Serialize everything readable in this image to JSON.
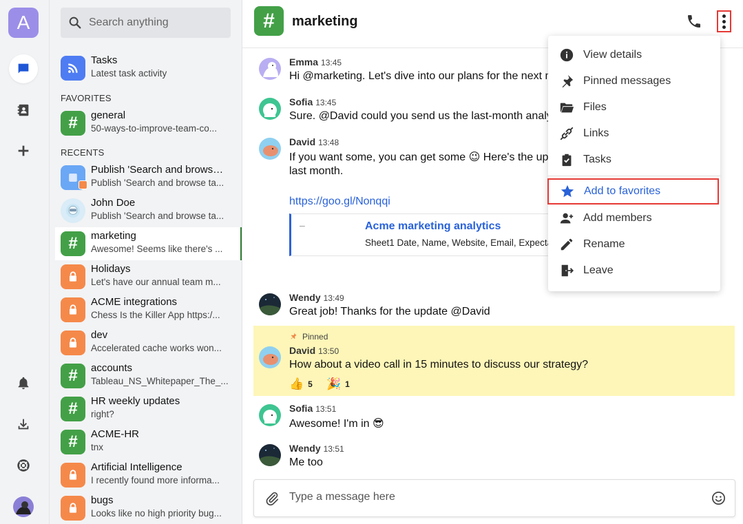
{
  "rail": {
    "avatar_letter": "A"
  },
  "search": {
    "placeholder": "Search anything"
  },
  "sidebar": {
    "tasks": {
      "title": "Tasks",
      "subtitle": "Latest task activity"
    },
    "favorites_label": "FAVORITES",
    "favorites": [
      {
        "title": "general",
        "subtitle": "50-ways-to-improve-team-co..."
      }
    ],
    "recents_label": "RECENTS",
    "recents": [
      {
        "title": "Publish 'Search and browse ...",
        "subtitle": "Publish 'Search and browse ta...",
        "icon": "task-icon"
      },
      {
        "title": "John Doe",
        "subtitle": "Publish 'Search and browse ta...",
        "icon": "avatar"
      },
      {
        "title": "marketing",
        "subtitle": "Awesome! Seems like there's ...",
        "icon": "hash-icon"
      },
      {
        "title": "Holidays",
        "subtitle": "Let's have our annual team m...",
        "icon": "lock-icon"
      },
      {
        "title": "ACME integrations",
        "subtitle": "Chess Is the Killer App https:/...",
        "icon": "lock-icon"
      },
      {
        "title": "dev",
        "subtitle": "Accelerated cache works won...",
        "icon": "lock-icon"
      },
      {
        "title": "accounts",
        "subtitle": "Tableau_NS_Whitepaper_The_...",
        "icon": "hash-icon"
      },
      {
        "title": "HR weekly updates",
        "subtitle": "right?",
        "icon": "hash-icon"
      },
      {
        "title": "ACME-HR",
        "subtitle": "tnx",
        "icon": "hash-icon"
      },
      {
        "title": "Artificial Intelligence",
        "subtitle": "I recently found more informa...",
        "icon": "lock-icon"
      },
      {
        "title": "bugs",
        "subtitle": "Looks like no high priority bug...",
        "icon": "lock-icon"
      }
    ]
  },
  "header": {
    "channel_icon": "#",
    "title": "marketing"
  },
  "messages": [
    {
      "name": "Emma",
      "time": "13:45",
      "text": "Hi @marketing. Let's dive into our plans for the next m"
    },
    {
      "name": "Sofia",
      "time": "13:45",
      "text": "Sure. @David could you send us the last-month analyt"
    },
    {
      "name": "David",
      "time": "13:48",
      "text": "If you want some, you can get some 😉 Here's the upc",
      "text2": "last month.",
      "link": "https://goo.gl/Nonqqi",
      "card": {
        "title": "Acme marketing analytics",
        "desc": "Sheet1 Date, Name, Website, Email, Expecta"
      }
    },
    {
      "name": "Wendy",
      "time": "13:49",
      "text": "Great job! Thanks for the update @David"
    },
    {
      "pinned_label": "Pinned",
      "name": "David",
      "time": "13:50",
      "text": "How about a video call in 15 minutes to discuss our strategy?",
      "reactions": [
        {
          "emoji": "👍",
          "count": "5"
        },
        {
          "emoji": "🎉",
          "count": "1"
        }
      ]
    },
    {
      "name": "Sofia",
      "time": "13:51",
      "text": "Awesome! I'm in 😎"
    },
    {
      "name": "Wendy",
      "time": "13:51",
      "text": "Me too"
    }
  ],
  "composer": {
    "placeholder": "Type a message here"
  },
  "menu": {
    "items": [
      {
        "label": "View details",
        "icon": "info-icon"
      },
      {
        "label": "Pinned messages",
        "icon": "pin-icon"
      },
      {
        "label": "Files",
        "icon": "folder-icon"
      },
      {
        "label": "Links",
        "icon": "link-icon"
      },
      {
        "label": "Tasks",
        "icon": "clipboard-icon"
      },
      {
        "label": "Add to favorites",
        "icon": "star-icon"
      },
      {
        "label": "Add members",
        "icon": "add-person-icon"
      },
      {
        "label": "Rename",
        "icon": "pencil-icon"
      },
      {
        "label": "Leave",
        "icon": "exit-icon"
      }
    ]
  },
  "colors": {
    "accent": "#2962d9",
    "channel_green": "#43a047",
    "private_orange": "#f5894a",
    "pinned_bg": "#fdf6b8",
    "highlight_border": "#e53935"
  }
}
